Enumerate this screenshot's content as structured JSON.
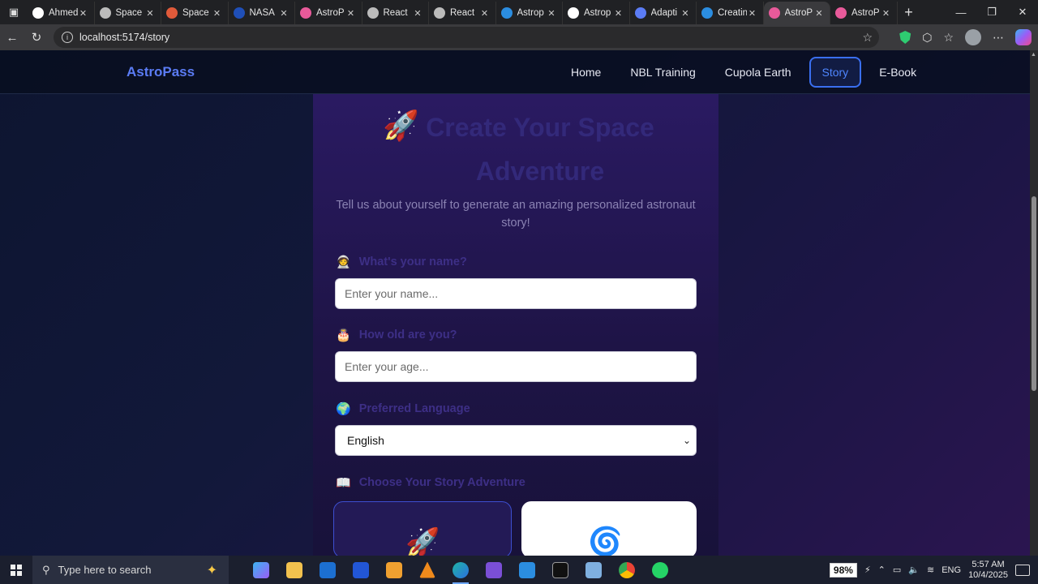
{
  "browser": {
    "tabs": [
      {
        "title": "Ahmed",
        "favicon": "github-icon",
        "color": "#ffffff"
      },
      {
        "title": "Space",
        "favicon": "globe-icon",
        "color": "#bbbbbb"
      },
      {
        "title": "Space",
        "favicon": "spark-icon",
        "color": "#e05a3a"
      },
      {
        "title": "NASA",
        "favicon": "nasa-icon",
        "color": "#1f4fb8"
      },
      {
        "title": "AstroP",
        "favicon": "astropass-icon",
        "color": "#e85a9a"
      },
      {
        "title": "React",
        "favicon": "react-icon",
        "color": "#bbbbbb"
      },
      {
        "title": "React",
        "favicon": "react-icon",
        "color": "#bbbbbb"
      },
      {
        "title": "Astrop",
        "favicon": "edge-icon",
        "color": "#2b8de0"
      },
      {
        "title": "Astrop",
        "favicon": "github-icon",
        "color": "#ffffff"
      },
      {
        "title": "Adapti",
        "favicon": "adapt-icon",
        "color": "#5b7cf5"
      },
      {
        "title": "Creatin",
        "favicon": "create-icon",
        "color": "#2b8de0"
      },
      {
        "title": "AstroP",
        "favicon": "astropass-icon",
        "color": "#e85a9a",
        "active": true
      },
      {
        "title": "AstroP",
        "favicon": "astropass-icon",
        "color": "#e85a9a"
      }
    ],
    "url": "localhost:5174/story"
  },
  "site": {
    "logo": "AstroPass",
    "nav": [
      {
        "label": "Home",
        "active": false
      },
      {
        "label": "NBL Training",
        "active": false
      },
      {
        "label": "Cupola Earth",
        "active": false
      },
      {
        "label": "Story",
        "active": true
      },
      {
        "label": "E-Book",
        "active": false
      }
    ]
  },
  "form": {
    "title": "Create Your Space Adventure",
    "subtitle": "Tell us about yourself to generate an amazing personalized astronaut story!",
    "name_label": "What's your name?",
    "name_placeholder": "Enter your name...",
    "age_label": "How old are you?",
    "age_placeholder": "Enter your age...",
    "language_label": "Preferred Language",
    "language_value": "English",
    "story_label": "Choose Your Story Adventure",
    "icons": {
      "title": "rocket-icon",
      "name": "astronaut-icon",
      "age": "cake-icon",
      "language": "globe-icon",
      "story": "book-icon"
    }
  },
  "taskbar": {
    "search_placeholder": "Type here to search",
    "battery": "98%",
    "language": "ENG",
    "time": "5:57 AM",
    "date": "10/4/2025"
  },
  "colors": {
    "accent": "#3a6ff0",
    "logo": "#5b7cf5",
    "label": "#3d2f86"
  }
}
